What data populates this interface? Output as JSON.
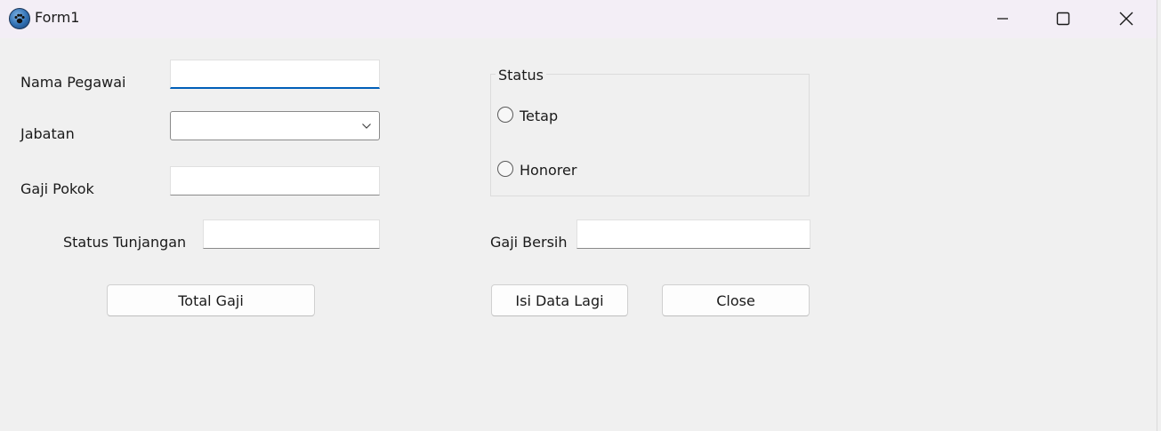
{
  "window": {
    "title": "Form1",
    "app_icon": "paw-icon",
    "controls": [
      "minimize-icon",
      "maximize-icon",
      "close-icon"
    ]
  },
  "form": {
    "nama_pegawai": {
      "label": "Nama Pegawai",
      "value": ""
    },
    "jabatan": {
      "label": "Jabatan",
      "value": ""
    },
    "gaji_pokok": {
      "label": "Gaji Pokok",
      "value": ""
    },
    "status_tunjangan": {
      "label": "Status Tunjangan",
      "value": ""
    },
    "gaji_bersih": {
      "label": "Gaji Bersih",
      "value": ""
    },
    "status_group": {
      "title": "Status",
      "options": [
        {
          "label": "Tetap",
          "checked": false
        },
        {
          "label": "Honorer",
          "checked": false
        }
      ]
    }
  },
  "buttons": {
    "total_gaji": "Total Gaji",
    "isi_data_lagi": "Isi Data Lagi",
    "close": "Close"
  },
  "colors": {
    "titlebar": "#f3eef6",
    "form_background": "#f0f0f0",
    "focus_accent": "#005fb8"
  }
}
